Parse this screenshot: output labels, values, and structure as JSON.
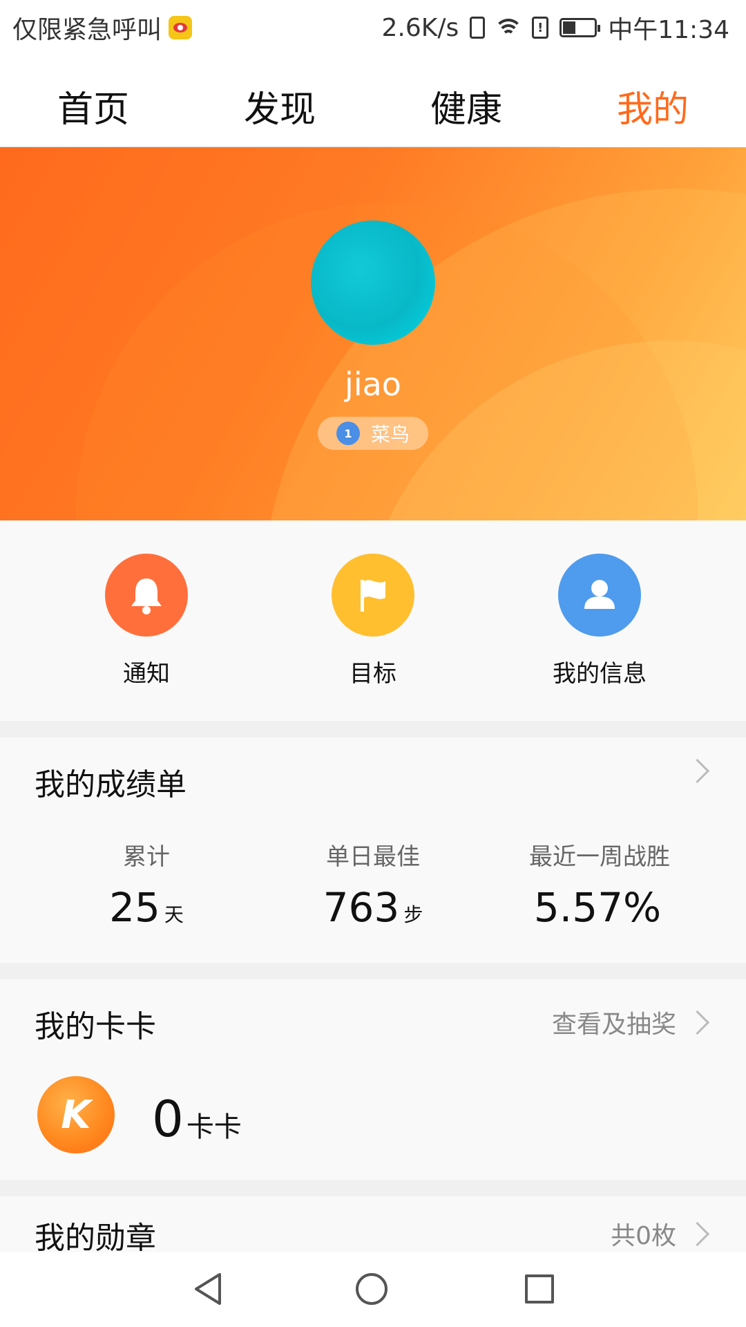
{
  "status_bar": {
    "carrier": "仅限紧急呼叫",
    "speed": "2.6K/s",
    "time": "中午11:34"
  },
  "tabs": [
    {
      "label": "首页"
    },
    {
      "label": "发现"
    },
    {
      "label": "健康"
    },
    {
      "label": "我的",
      "active": true
    }
  ],
  "profile": {
    "username": "jiao",
    "level_number": "1",
    "level_name": "菜鸟"
  },
  "actions": [
    {
      "label": "通知",
      "icon": "bell-icon",
      "color": "#ff6f3c"
    },
    {
      "label": "目标",
      "icon": "flag-icon",
      "color": "#ffbf2f"
    },
    {
      "label": "我的信息",
      "icon": "user-icon",
      "color": "#4f9bee"
    }
  ],
  "report": {
    "title": "我的成绩单",
    "stats": [
      {
        "label": "累计",
        "value": "25",
        "unit": "天"
      },
      {
        "label": "单日最佳",
        "value": "763",
        "unit": "步"
      },
      {
        "label": "最近一周战胜",
        "value": "5.57%",
        "unit": ""
      }
    ]
  },
  "kaka": {
    "title": "我的卡卡",
    "link": "查看及抽奖",
    "amount": "0",
    "unit": "卡卡"
  },
  "medals": {
    "title": "我的勋章",
    "count": "共0枚"
  },
  "colors": {
    "accent": "#ff6a1c"
  }
}
